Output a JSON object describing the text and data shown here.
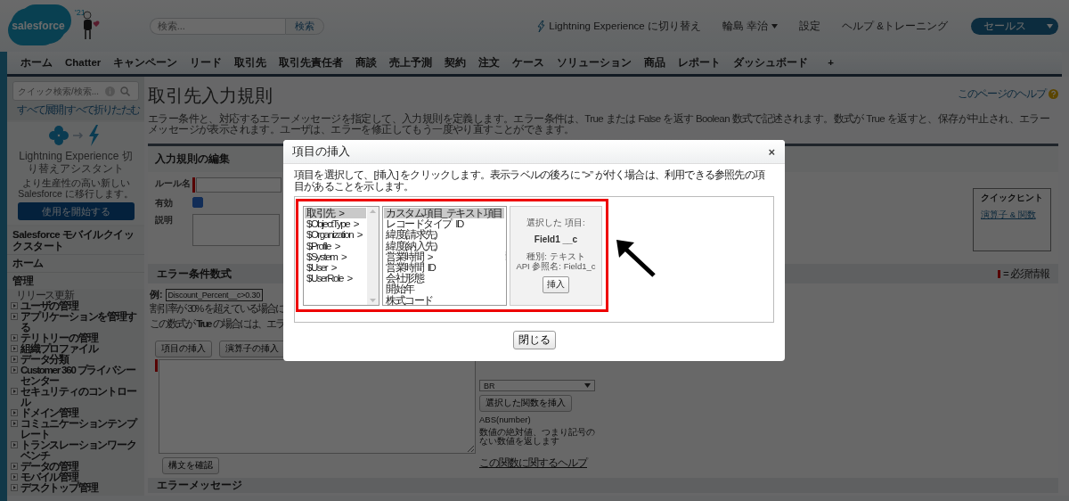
{
  "header": {
    "logo": "salesforce",
    "logo_year": "'21",
    "search": {
      "placeholder": "検索..."
    },
    "search_button": "検索",
    "links": [
      {
        "kind": "lightning",
        "label": "Lightning Experience に切り替え"
      },
      {
        "kind": "menu",
        "label": "輪島 幸治"
      },
      {
        "kind": "plain",
        "label": "設定"
      },
      {
        "kind": "plain",
        "label": "ヘルプ &トレーニング"
      }
    ],
    "app_menu": "セールス"
  },
  "tabs": [
    {
      "label": "ホーム",
      "selected": false
    },
    {
      "label": "Chatter",
      "selected": false
    },
    {
      "label": "キャンペーン",
      "selected": false
    },
    {
      "label": "リード",
      "selected": false
    },
    {
      "label": "取引先",
      "selected": false
    },
    {
      "label": "取引先責任者",
      "selected": false
    },
    {
      "label": "商談",
      "selected": false
    },
    {
      "label": "売上予測",
      "selected": false
    },
    {
      "label": "契約",
      "selected": false
    },
    {
      "label": "注文",
      "selected": false
    },
    {
      "label": "ケース",
      "selected": false
    },
    {
      "label": "ソリューション",
      "selected": false
    },
    {
      "label": "商品",
      "selected": false
    },
    {
      "label": "レポート",
      "selected": false
    },
    {
      "label": "ダッシュボード",
      "selected": false
    }
  ],
  "add_tab": "+",
  "sidebar": {
    "quick_find": {
      "placeholder": "クイック検索/検索..."
    },
    "expand_all": "すべて展開",
    "separator": "|",
    "collapse_all": "すべて折りたたむ",
    "lightning_card": {
      "title": "Lightning Experience 切り替えアシスタント",
      "text": "より生産性の高い新しい Salesforce に移行します。",
      "button": "使用を開始する"
    },
    "sections": [
      {
        "label": "Salesforce モバイルクイックスタート"
      },
      {
        "label": "ホーム"
      },
      {
        "label": "管理",
        "items": [
          {
            "kind": "link",
            "label": "リリース更新"
          },
          {
            "kind": "folder",
            "label": "ユーザの管理",
            "expanded": false
          },
          {
            "kind": "folder",
            "label": "アプリケーションを管理する",
            "expanded": false
          },
          {
            "kind": "folder",
            "label": "テリトリーの管理",
            "expanded": false
          },
          {
            "kind": "folder",
            "label": "組織プロファイル",
            "expanded": false
          },
          {
            "kind": "folder",
            "label": "データ分類",
            "expanded": false
          },
          {
            "kind": "folder",
            "label": "Customer 360 プライバシーセンター",
            "expanded": false
          },
          {
            "kind": "folder",
            "label": "セキュリティのコントロール",
            "expanded": false
          },
          {
            "kind": "folder",
            "label": "ドメイン管理",
            "expanded": false
          },
          {
            "kind": "folder",
            "label": "コミュニケーションテンプレート",
            "expanded": false
          },
          {
            "kind": "folder",
            "label": "トランスレーションワークベンチ",
            "expanded": false
          },
          {
            "kind": "folder",
            "label": "データの管理",
            "expanded": false
          },
          {
            "kind": "folder",
            "label": "モバイル管理",
            "expanded": false
          },
          {
            "kind": "folder",
            "label": "デスクトップ管理",
            "expanded": false
          }
        ]
      }
    ]
  },
  "main": {
    "title": "取引先入力規則",
    "help_link": "このページのヘルプ",
    "description": "エラー条件と、対応するエラーメッセージを指定して、入力規則を定義します。エラー条件は、True または False を返す Boolean 数式で記述されます。数式が True を返すと、保存が中止され、エラーメッセージが表示されます。ユーザは、エラーを修正してもう一度やり直すことができます。",
    "edit_section": {
      "title": "入力規則の編集",
      "fields": [
        {
          "kind": "text",
          "label": "ルール名",
          "required": true
        },
        {
          "kind": "checkbox",
          "label": "有効",
          "checked": true
        },
        {
          "kind": "textarea",
          "label": "説明"
        }
      ]
    },
    "quick_hint": {
      "title": "クイックヒント",
      "links": [
        "演算子 & 関数"
      ]
    },
    "formula_section": {
      "title": "エラー条件数式",
      "legend": "= 必須情報",
      "example_label": "例:",
      "example_code": "Discount_Percent__c>0.30",
      "example_text": "割引率が 30% を超えている場合に",
      "true_text": "この数式が **True** の場合には、エラ",
      "buttons": [
        {
          "kind": "plain",
          "label": "項目の挿入"
        },
        {
          "kind": "dropdown",
          "label": "演算子の挿入"
        }
      ],
      "required": true,
      "check_button": "構文を確認",
      "function_select": "BR",
      "insert_function": "選択した関数を挿入",
      "function_signature": "ABS(number)",
      "function_description": "数値の絶対値、つまり記号のない数値を返します",
      "function_help": "この関数に関するヘルプ"
    },
    "error_message_section": {
      "title": "エラーメッセージ"
    }
  },
  "modal": {
    "title": "項目の挿入",
    "close": "×",
    "instruction": "項目を選択して、[挿入] をクリックします。表示ラベルの後ろに “>” が付く場合は、利用できる参照先の項目があることを示します。",
    "lists": [
      {
        "items": [
          {
            "label": "取引先 >",
            "selected": true
          },
          {
            "label": "$ObjectType >",
            "selected": false
          },
          {
            "label": "$Organization >",
            "selected": false
          },
          {
            "label": "$Profile >",
            "selected": false
          },
          {
            "label": "$System >",
            "selected": false
          },
          {
            "label": "$User >",
            "selected": false
          },
          {
            "label": "$UserRole >",
            "selected": false
          }
        ]
      },
      {
        "items": [
          {
            "label": "カスタム項目_テキスト項目",
            "selected": true
          },
          {
            "label": "レコードタイプ ID",
            "selected": false
          },
          {
            "label": "緯度(請求先)",
            "selected": false
          },
          {
            "label": "緯度(納入先)",
            "selected": false
          },
          {
            "label": "営業時間 >",
            "selected": false
          },
          {
            "label": "営業時間 ID",
            "selected": false
          },
          {
            "label": "会社形態",
            "selected": false
          },
          {
            "label": "開始年",
            "selected": false
          },
          {
            "label": "株式コード",
            "selected": false
          }
        ]
      }
    ],
    "selected_field": {
      "heading": "選択した 項目:",
      "name": "Field1 __c",
      "type": "種別: テキスト",
      "api_name": "API 参照名: Field1_c",
      "insert_button": "挿入"
    },
    "close_button": "閉じる"
  }
}
